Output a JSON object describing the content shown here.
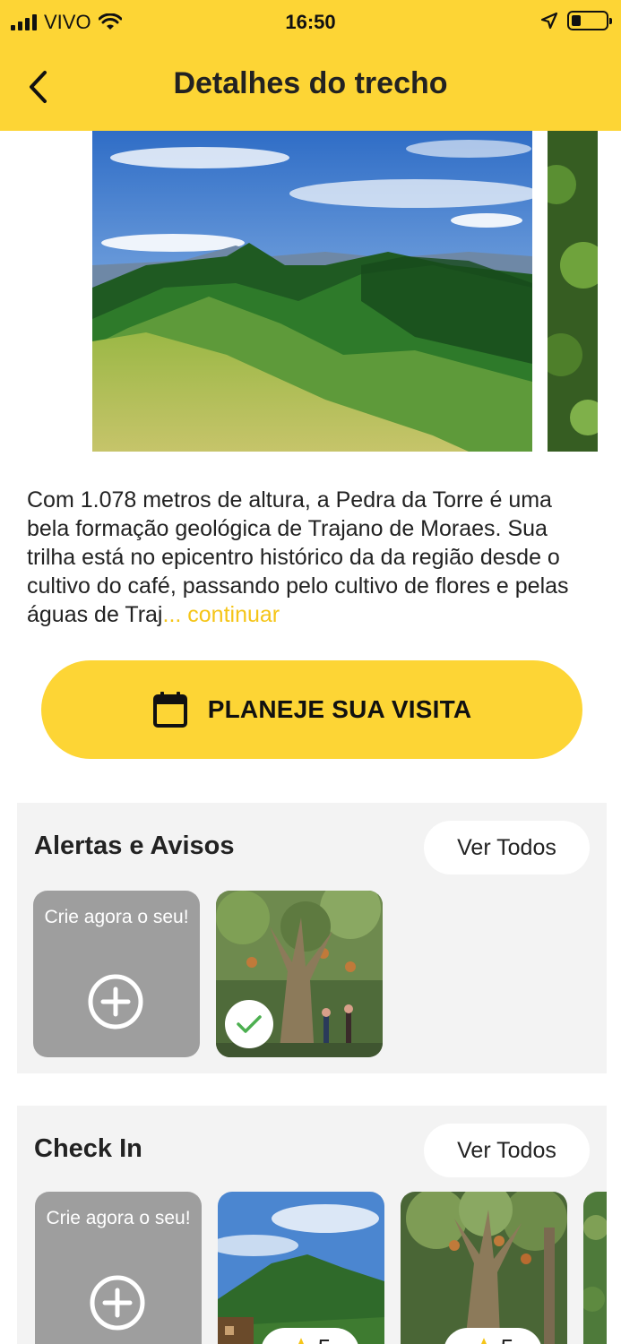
{
  "status": {
    "carrier": "VIVO",
    "time": "16:50"
  },
  "header": {
    "title": "Detalhes do trecho"
  },
  "description": {
    "text": "Com 1.078 metros de altura, a Pedra da Torre é uma bela formação geológica de Trajano de Moraes. Sua trilha está no epicentro histórico da da região desde o cultivo do café, passando pelo cultivo de flores e pelas águas de Traj",
    "more_label": "... continuar"
  },
  "cta": {
    "label": "PLANEJE SUA VISITA",
    "icon": "calendar-icon"
  },
  "alerts": {
    "title": "Alertas e Avisos",
    "see_all": "Ver Todos",
    "create_label": "Crie agora o seu!"
  },
  "checkin": {
    "title": "Check In",
    "see_all": "Ver Todos",
    "create_label": "Crie agora o seu!",
    "items": [
      {
        "rating": "5"
      },
      {
        "rating": "5"
      }
    ]
  },
  "colors": {
    "accent": "#FDD535",
    "link": "#F5C518",
    "card_gray": "#9E9E9E",
    "section_bg": "#F3F3F3"
  }
}
